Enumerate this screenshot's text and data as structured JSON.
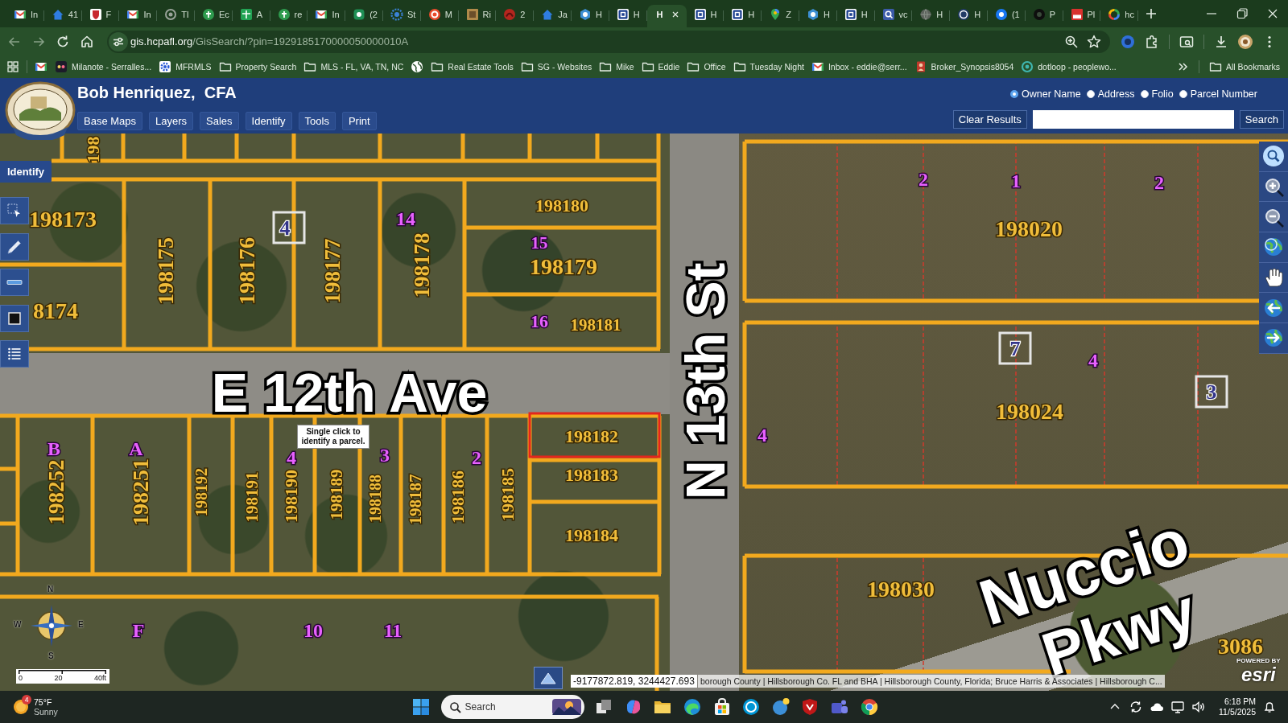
{
  "browser": {
    "tabs": [
      {
        "title": "In",
        "selected": false
      },
      {
        "title": "41",
        "selected": false
      },
      {
        "title": "F",
        "selected": false
      },
      {
        "title": "In",
        "selected": false
      },
      {
        "title": "Tl",
        "selected": false
      },
      {
        "title": "Ec",
        "selected": false
      },
      {
        "title": "A",
        "selected": false
      },
      {
        "title": "re",
        "selected": false
      },
      {
        "title": "In",
        "selected": false
      },
      {
        "title": "(2",
        "selected": false
      },
      {
        "title": "St",
        "selected": false
      },
      {
        "title": "M",
        "selected": false
      },
      {
        "title": "Ri",
        "selected": false
      },
      {
        "title": "2",
        "selected": false
      },
      {
        "title": "Ja",
        "selected": false
      },
      {
        "title": "H",
        "selected": false
      },
      {
        "title": "H",
        "selected": false
      },
      {
        "title": "H",
        "selected": true
      },
      {
        "title": "H",
        "selected": false
      },
      {
        "title": "H",
        "selected": false
      },
      {
        "title": "Z",
        "selected": false
      },
      {
        "title": "H",
        "selected": false
      },
      {
        "title": "H",
        "selected": false
      },
      {
        "title": "vc",
        "selected": false
      },
      {
        "title": "H",
        "selected": false
      },
      {
        "title": "H",
        "selected": false
      },
      {
        "title": "(1",
        "selected": false
      },
      {
        "title": "P",
        "selected": false
      },
      {
        "title": "Pl",
        "selected": false
      },
      {
        "title": "hc",
        "selected": false
      }
    ],
    "address": {
      "host": "gis.hcpafl.org",
      "path": "/GisSearch/?pin=1929185170000050000010A"
    },
    "bookmarks": [
      "Milanote - Serralles...",
      "MFRMLS",
      "Property Search",
      "MLS - FL, VA, TN, NC",
      "Real Estate Tools",
      "SG - Websites",
      "Mike",
      "Eddie",
      "Office",
      "Tuesday Night",
      "Inbox - eddie@serr...",
      "Broker_Synopsis8054",
      "dotloop - peoplewo..."
    ],
    "all_bookmarks": "All Bookmarks"
  },
  "page": {
    "title": "Bob Henriquez,  CFA",
    "nav": [
      "Base Maps",
      "Layers",
      "Sales",
      "Identify",
      "Tools",
      "Print"
    ],
    "search_by": [
      {
        "label": "Owner Name",
        "selected": true
      },
      {
        "label": "Address",
        "selected": false
      },
      {
        "label": "Folio",
        "selected": false
      },
      {
        "label": "Parcel Number",
        "selected": false
      }
    ],
    "clear_button": "Clear Results",
    "search_button": "Search"
  },
  "map": {
    "identify_tab": "Identify",
    "labels": [
      {
        "text": "198",
        "kind": "parcel",
        "selected": false
      },
      {
        "text": "198173",
        "kind": "parcel",
        "selected": false
      },
      {
        "text": "4",
        "kind": "lot_box"
      },
      {
        "text": "14",
        "kind": "lot"
      },
      {
        "text": "198180",
        "kind": "parcel",
        "selected": false
      },
      {
        "text": "198175",
        "kind": "parcel",
        "selected": false
      },
      {
        "text": "198176",
        "kind": "parcel",
        "selected": false
      },
      {
        "text": "198177",
        "kind": "parcel",
        "selected": false
      },
      {
        "text": "198178",
        "kind": "parcel",
        "selected": false
      },
      {
        "text": "15",
        "kind": "lot"
      },
      {
        "text": "198179",
        "kind": "parcel",
        "selected": false
      },
      {
        "text": "8174",
        "kind": "parcel",
        "selected": false
      },
      {
        "text": "16",
        "kind": "lot"
      },
      {
        "text": "198181",
        "kind": "parcel",
        "selected": false
      },
      {
        "text": "2",
        "kind": "lot"
      },
      {
        "text": "1",
        "kind": "lot"
      },
      {
        "text": "2",
        "kind": "lot"
      },
      {
        "text": "198020",
        "kind": "parcel",
        "selected": false
      },
      {
        "text": "7",
        "kind": "lot_box"
      },
      {
        "text": "4",
        "kind": "lot"
      },
      {
        "text": "3",
        "kind": "lot_box"
      },
      {
        "text": "E 12th Ave",
        "kind": "street"
      },
      {
        "text": "N 13th St",
        "kind": "street"
      },
      {
        "text": "198024",
        "kind": "parcel",
        "selected": false
      },
      {
        "text": "4",
        "kind": "lot"
      },
      {
        "text": "198182",
        "kind": "parcel",
        "selected": true
      },
      {
        "text": "B",
        "kind": "lot"
      },
      {
        "text": "A",
        "kind": "lot"
      },
      {
        "text": "4",
        "kind": "lot"
      },
      {
        "text": "3",
        "kind": "lot"
      },
      {
        "text": "2",
        "kind": "lot"
      },
      {
        "text": "198183",
        "kind": "parcel",
        "selected": false
      },
      {
        "text": "198252",
        "kind": "parcel",
        "selected": false
      },
      {
        "text": "198251",
        "kind": "parcel",
        "selected": false
      },
      {
        "text": "198192",
        "kind": "parcel",
        "selected": false
      },
      {
        "text": "198191",
        "kind": "parcel",
        "selected": false
      },
      {
        "text": "198190",
        "kind": "parcel",
        "selected": false
      },
      {
        "text": "198189",
        "kind": "parcel",
        "selected": false
      },
      {
        "text": "198188",
        "kind": "parcel",
        "selected": false
      },
      {
        "text": "198187",
        "kind": "parcel",
        "selected": false
      },
      {
        "text": "198186",
        "kind": "parcel",
        "selected": false
      },
      {
        "text": "198185",
        "kind": "parcel",
        "selected": false
      },
      {
        "text": "198184",
        "kind": "parcel",
        "selected": false
      },
      {
        "text": "Nuccio",
        "kind": "street"
      },
      {
        "text": "198030",
        "kind": "parcel",
        "selected": false
      },
      {
        "text": "Pkwy",
        "kind": "street"
      },
      {
        "text": "3086",
        "kind": "parcel",
        "selected": false
      },
      {
        "text": "F",
        "kind": "lot"
      },
      {
        "text": "10",
        "kind": "lot"
      },
      {
        "text": "11",
        "kind": "lot"
      }
    ],
    "tooltip": "Single click to identify a parcel.",
    "compass": [
      "N",
      "W",
      "E",
      "S"
    ],
    "scale": [
      "0",
      "20",
      "40ft"
    ],
    "coordinates": "-9177872.819, 3244427.693",
    "attribution": "borough County | Hillsborough Co. FL and BHA | Hillsborough County, Florida; Bruce Harris & Associates | Hillsborough C...",
    "esri": {
      "tagline": "POWERED BY",
      "name": "esri"
    }
  },
  "taskbar": {
    "weather": {
      "badge": "4",
      "temperature": "75°F",
      "condition": "Sunny"
    },
    "search": {
      "placeholder": "Search"
    },
    "time": "6:18 PM",
    "date": "11/5/2025"
  }
}
